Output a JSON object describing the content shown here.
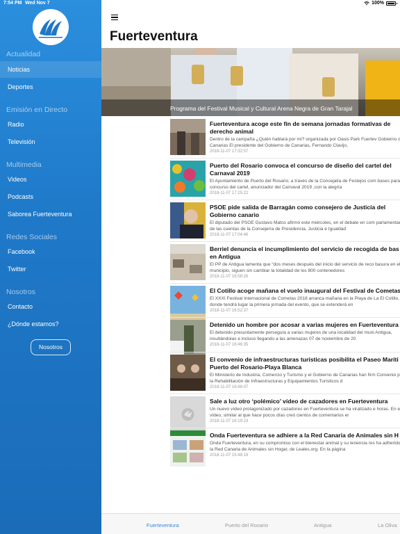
{
  "status": {
    "time": "7:54 PM",
    "date": "Wed Nov 7",
    "battery": "100%"
  },
  "sidebar": {
    "sections": [
      {
        "title": "Actualidad",
        "items": [
          "Noticias",
          "Deportes"
        ]
      },
      {
        "title": "Emisión en Directo",
        "items": [
          "Radio",
          "Televisión"
        ]
      },
      {
        "title": "Multimedia",
        "items": [
          "Videos",
          "Podcasts",
          "Saborea Fuerteventura"
        ]
      },
      {
        "title": "Redes Sociales",
        "items": [
          "Facebook",
          "Twitter"
        ]
      },
      {
        "title": "Nosotros",
        "items": [
          "Contacto",
          "¿Dónde estamos?"
        ]
      }
    ],
    "button_label": "Nosotros"
  },
  "header": {
    "title": "Fuerteventura"
  },
  "hero": {
    "caption": "Programa del Festival Musical y Cultural Arena Negra de Gran Tarajal"
  },
  "news": [
    {
      "title": "Fuerteventura acoge este fin de semana jornadas formativas de derecho animal",
      "desc": "Dentro de la campaña ¿Quién hablará por mí? organizada por Oasis Park Fuertev Gobierno de Canarias El presidente del Gobierno de Canarias, Fernando Clavijo,",
      "date": "2018-11-07 17:32:57"
    },
    {
      "title": "Puerto del Rosario convoca el concurso de diseño del cartel del Carnaval 2019",
      "desc": "El Ayuntamiento de Puerto del Rosario, a través de la Concejalía de Festejos com bases para el concurso del cartel, anunciador del Carnaval 2019 ,con la alegría",
      "date": "2018-11-07 17:25:22"
    },
    {
      "title": "PSOE pide salida de Barragán como consejero de Justicia del Gobierno canario",
      "desc": "El diputado del PSOE Gustavo Matos afirmó este miércoles, en el debate en com parlamentaria de las cuentas de la Consejería de Presidencia, Justicia e Igualdad",
      "date": "2018-11-07 17:04:46"
    },
    {
      "title": "Berriel denuncia el incumplimiento del servicio de recogida de bas en Antigua",
      "desc": "El PP de Antigua lamenta que “dos meses después del inicio del servicio de reco basura en el municipio, siguen sin cambiar la totalidad de los 800 contenedores",
      "date": "2018-11-07 16:58:26"
    },
    {
      "title": "El Cotillo acoge mañana el vuelo inaugural del Festival de Cometas",
      "desc": "El XXXI Festival Internacional de Cometas 2018 arranca mañana en la Playa de La El Cotillo, donde tendrá lugar la primera jornada del evento, que se extenderá en",
      "date": "2018-11-07 16:52:37"
    },
    {
      "title": "Detenido un hombre por acosar a varias mujeres en Fuerteventura",
      "desc": "El detenido presuntamente perseguía a varias mujeres de una localidad del muni Antigua, insultándolas e incluso llegando a las amenazas 07 de noviembre de 20",
      "date": "2018-11-07 16:46:35"
    },
    {
      "title": "El convenio de infraestructuras turísticas posibilita el Paseo Maríti Puerto del Rosario-Playa Blanca",
      "desc": "El Ministerio de Industria, Comercio y Turismo y el Gobierno de Canarias han firm Convenio para la Rehabilitación de Infraestructuras y Equipamientos Turísticos d",
      "date": "2018-11-07 16:46:07"
    },
    {
      "title": "Sale a luz otro ‘polémico’ vídeo de cazadores en Fuerteventura",
      "desc": "Un nuevo vídeo protagonizado por cazadores en Fuerteventura se ha viralizado e horas. En el vídeo, similar al que hace pocos días creó cientos de comentarios er",
      "date": "2018-11-07 16:19:23"
    },
    {
      "title": "Onda Fuerteventura se adhiere a la Red Canaria de Animales sin H",
      "desc": "Onda Fuerteventura, en su compromiso con el bienestar animal y su tenencia res ha adherido a la Red Canaria de Animales sin Hogar, de Leales.org. En la página",
      "date": "2018-11-07 15:48:19"
    }
  ],
  "tabs": [
    "Fuerteventura",
    "Puerto del Rosario",
    "Antigua",
    "La Oliva"
  ],
  "colors": {
    "sidebar": "#2384d3",
    "tab_active": "#3a86d6"
  }
}
